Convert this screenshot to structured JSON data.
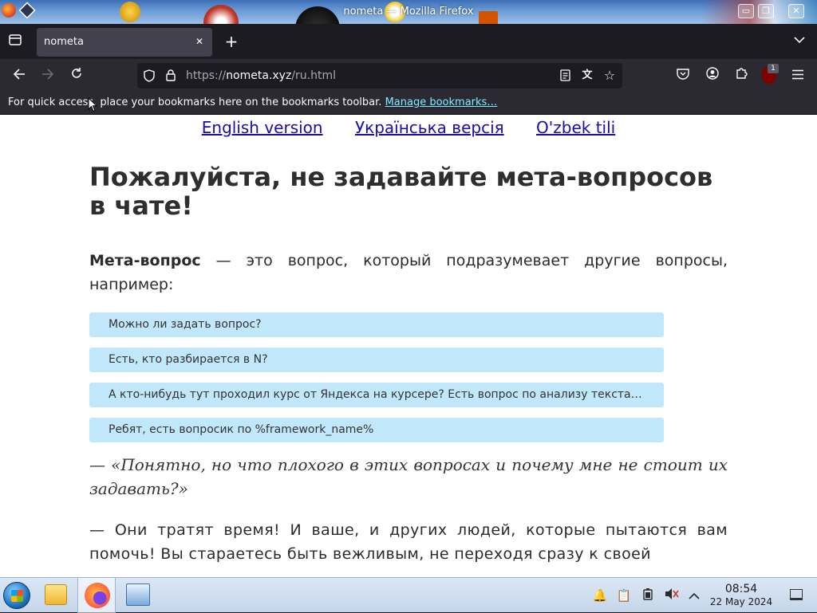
{
  "window": {
    "title": "nometa — Mozilla Firefox",
    "controls": {
      "minimize": "▭",
      "maximize": "❐",
      "close": "✕"
    }
  },
  "tabs": [
    {
      "label": "nometa",
      "active": true
    }
  ],
  "navbar": {
    "url_scheme": "https://",
    "url_host": "nometa.xyz",
    "url_path": "/ru.html",
    "ublock_badge": "1"
  },
  "bookmarks_bar": {
    "message": "For quick access, place your bookmarks here on the bookmarks toolbar.",
    "link": "Manage bookmarks…"
  },
  "page": {
    "languages": [
      "English version",
      "Українська версія",
      "O'zbek tili"
    ],
    "heading": "Пожалуйста, не задавайте мета-вопросов в чате!",
    "intro_bold": "Мета-вопрос",
    "intro_rest": " — это вопрос, который подразумевает другие вопросы, например:",
    "examples": [
      "Можно ли задать вопрос?",
      "Есть, кто разбирается в N?",
      "А кто-нибудь тут проходил курс от Яндекса на курсере? Есть вопрос по анализу текста…",
      "Ребят, есть вопросик по %framework_name%"
    ],
    "quote": "— «Понятно, но что плохого в этих вопросах и почему мне не стоит их задавать?»",
    "answer": "— Они тратят время! И ваше, и других людей, которые пытаются вам помочь! Вы стараетесь быть вежливым, не переходя сразу к своей"
  },
  "taskbar": {
    "time": "08:54",
    "date": "22 May 2024"
  },
  "colors": {
    "example_bg": "#c1e8fa",
    "link": "#1a0dab",
    "bookmark_link": "#80ebff"
  }
}
